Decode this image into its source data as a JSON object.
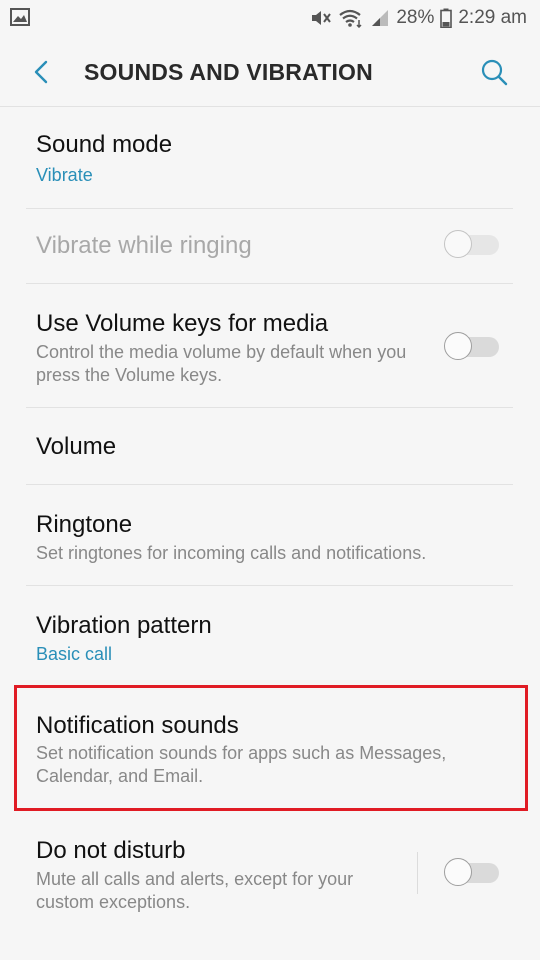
{
  "status_bar": {
    "battery": "28%",
    "time": "2:29 am"
  },
  "header": {
    "title": "SOUNDS AND VIBRATION"
  },
  "items": [
    {
      "title": "Sound mode",
      "subtitle": "Vibrate"
    },
    {
      "title": "Vibrate while ringing",
      "toggle": "off",
      "enabled": false
    },
    {
      "title": "Use Volume keys for media",
      "subtitle": "Control the media volume by default when you press the Volume keys.",
      "toggle": "off"
    },
    {
      "title": "Volume"
    },
    {
      "title": "Ringtone",
      "subtitle": "Set ringtones for incoming calls and notifications."
    },
    {
      "title": "Vibration pattern",
      "subtitle": "Basic call"
    },
    {
      "title": "Notification sounds",
      "subtitle": "Set notification sounds for apps such as Messages, Calendar, and Email."
    },
    {
      "title": "Do not disturb",
      "subtitle": "Mute all calls and alerts, except for your custom exceptions.",
      "toggle": "off"
    }
  ],
  "colors": {
    "accent": "#2a8fb8",
    "highlight": "#e01b24",
    "background": "#f6f6f6"
  }
}
